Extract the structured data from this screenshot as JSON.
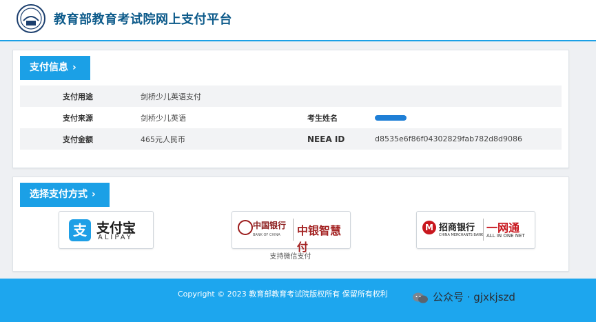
{
  "header": {
    "site_title": "教育部教育考试院网上支付平台"
  },
  "payment_info": {
    "section_label": "支付信息",
    "rows": [
      {
        "label": "支付用途",
        "value": "剑桥少儿英语支付"
      },
      {
        "label": "支付来源",
        "value": "剑桥少儿英语",
        "label2": "考生姓名",
        "value2": ""
      },
      {
        "label": "支付金额",
        "value": "465元人民币",
        "label2": "NEEA ID",
        "value2": "d8535e6f86f04302829fab782d8d9086"
      }
    ]
  },
  "payment_method": {
    "section_label": "选择支付方式",
    "alipay": {
      "name": "支付宝",
      "en": "ALIPAY"
    },
    "boc": {
      "bank_name": "中国银行",
      "bank_en": "BANK OF CHINA",
      "service": "中银智慧付"
    },
    "cmb": {
      "bank_name": "招商银行",
      "bank_en": "CHINA MERCHANTS BANK",
      "service": "一网通",
      "service_en": "ALL IN ONE NET"
    },
    "wechat_note": "支持微信支付"
  },
  "footer": {
    "copyright": "Copyright © 2023 教育部教育考试院版权所有 保留所有权利"
  },
  "watermark": {
    "text": "公众号 · gjxkjszd"
  },
  "colors": {
    "accent": "#1ba0e6",
    "footer": "#1da6ee"
  }
}
